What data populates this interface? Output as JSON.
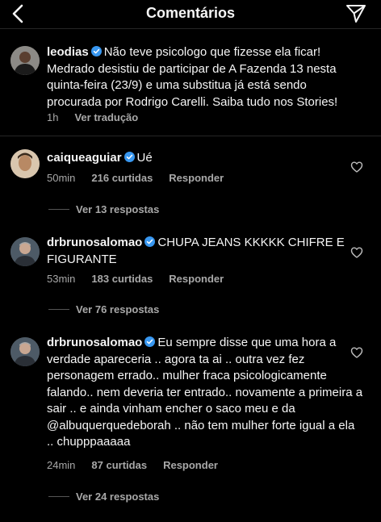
{
  "header": {
    "title": "Comentários"
  },
  "caption": {
    "username": "leodias",
    "text": "Não teve psicologo que fizesse ela ficar! Medrado desistiu de participar de A Fazenda 13 nesta quinta-feira (23/9) e uma substitua já está sendo procurada por Rodrigo Carelli. Saiba tudo nos Stories!",
    "time": "1h",
    "translate": "Ver tradução"
  },
  "comments": [
    {
      "username": "caiqueaguiar",
      "text": "Ué",
      "time": "50min",
      "likes": "216 curtidas",
      "reply": "Responder",
      "view_replies": "Ver 13 respostas"
    },
    {
      "username": "drbrunosalomao",
      "text": "CHUPA JEANS KKKKK CHIFRE E FIGURANTE",
      "time": "53min",
      "likes": "183 curtidas",
      "reply": "Responder",
      "view_replies": "Ver 76 respostas"
    },
    {
      "username": "drbrunosalomao",
      "text": "Eu sempre disse que uma hora a verdade apareceria .. agora ta ai .. outra vez fez personagem errado.. mulher fraca psicologicamente falando.. nem deveria ter entrado.. novamente a primeira a sair .. e ainda vinham encher o saco meu e da @albuquerquedeborah .. não tem mulher forte igual a ela .. chupppaaaaa",
      "time": "24min",
      "likes": "87 curtidas",
      "reply": "Responder",
      "view_replies": "Ver 24 respostas"
    }
  ],
  "colors": {
    "background": "#000000",
    "text": "#f5f5f5",
    "secondary": "#a8a8a8",
    "verified": "#3897f0"
  }
}
